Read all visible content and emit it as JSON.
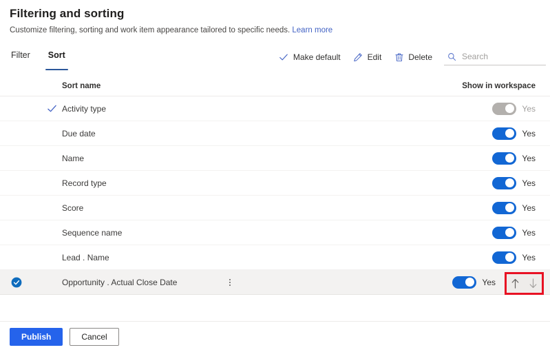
{
  "header": {
    "title": "Filtering and sorting",
    "subtitle": "Customize filtering, sorting and work item appearance tailored to specific needs.",
    "learn_more": "Learn more",
    "link_color": "#4262c4"
  },
  "tabs": [
    {
      "label": "Filter",
      "active": false
    },
    {
      "label": "Sort",
      "active": true
    }
  ],
  "toolbar": {
    "make_default": "Make default",
    "edit": "Edit",
    "delete": "Delete",
    "search_placeholder": "Search",
    "search_value": ""
  },
  "table": {
    "columns": {
      "sort_name": "Sort name",
      "show_in_workspace": "Show in workspace"
    },
    "rows": [
      {
        "name": "Activity type",
        "is_default": true,
        "selected": false,
        "toggle_on": true,
        "toggle_disabled": true,
        "toggle_label": "Yes"
      },
      {
        "name": "Due date",
        "is_default": false,
        "selected": false,
        "toggle_on": true,
        "toggle_disabled": false,
        "toggle_label": "Yes"
      },
      {
        "name": "Name",
        "is_default": false,
        "selected": false,
        "toggle_on": true,
        "toggle_disabled": false,
        "toggle_label": "Yes"
      },
      {
        "name": "Record type",
        "is_default": false,
        "selected": false,
        "toggle_on": true,
        "toggle_disabled": false,
        "toggle_label": "Yes"
      },
      {
        "name": "Score",
        "is_default": false,
        "selected": false,
        "toggle_on": true,
        "toggle_disabled": false,
        "toggle_label": "Yes"
      },
      {
        "name": "Sequence name",
        "is_default": false,
        "selected": false,
        "toggle_on": true,
        "toggle_disabled": false,
        "toggle_label": "Yes"
      },
      {
        "name": "Lead . Name",
        "is_default": false,
        "selected": false,
        "toggle_on": true,
        "toggle_disabled": false,
        "toggle_label": "Yes"
      },
      {
        "name": "Opportunity . Actual Close Date",
        "is_default": false,
        "selected": true,
        "toggle_on": true,
        "toggle_disabled": false,
        "toggle_label": "Yes",
        "has_overflow_menu": true,
        "has_reorder_arrows": true
      }
    ]
  },
  "reorder": {
    "move_up": "↑",
    "move_down": "↓",
    "highlight_color": "#e81123"
  },
  "footer": {
    "publish": "Publish",
    "cancel": "Cancel",
    "primary_color": "#2563eb"
  }
}
